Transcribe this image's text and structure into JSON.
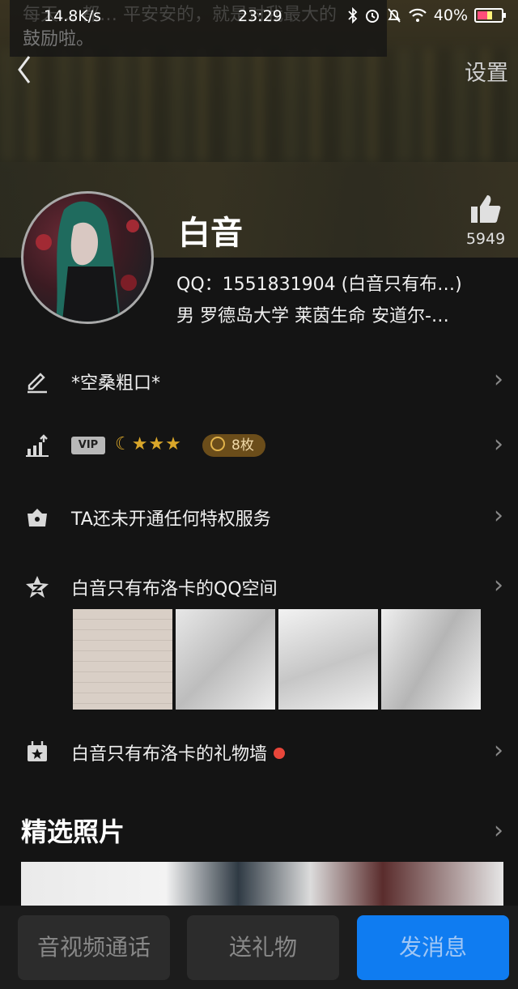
{
  "status_bar": {
    "speed": "14.8K/s",
    "time": "23:29",
    "battery": "40%"
  },
  "toast": {
    "line1": "每天… 都… 平安安的，就是对我最大的",
    "line2": "鼓励啦。"
  },
  "header": {
    "back_icon": "chevron-left-icon",
    "settings_label": "设置"
  },
  "profile": {
    "nickname": "白音",
    "likes": "5949",
    "qq_line": "QQ：1551831904 (白音只有布…)",
    "info_line": "男  罗德岛大学  莱茵生命 安道尔-…"
  },
  "rows": {
    "signature": "*空桑粗口*",
    "vip_label": "VIP",
    "level_stars": "☾★★★",
    "badge_count": "8枚",
    "privilege": "TA还未开通任何特权服务",
    "qzone": "白音只有布洛卡的QQ空间",
    "gift_wall": "白音只有布洛卡的礼物墙"
  },
  "featured": {
    "title": "精选照片"
  },
  "bottom": {
    "call": "音视频通话",
    "gift": "送礼物",
    "message": "发消息"
  },
  "colors": {
    "background": "#141414",
    "accent_blue": "#0f7cf1",
    "badge_gold": "#d9a62a",
    "red_dot": "#e8463a"
  }
}
